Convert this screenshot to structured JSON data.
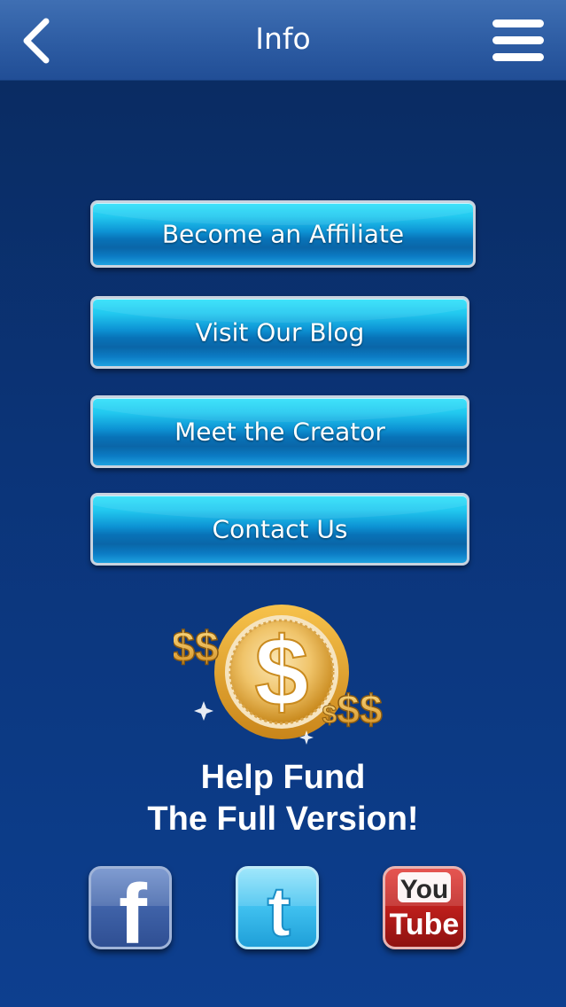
{
  "header": {
    "title": "Info",
    "back_icon": "chevron-left-icon",
    "menu_icon": "hamburger-menu-icon"
  },
  "menu": {
    "items": [
      {
        "label": "Become an Affiliate"
      },
      {
        "label": "Visit Our Blog"
      },
      {
        "label": "Meet the Creator"
      },
      {
        "label": "Contact Us"
      }
    ]
  },
  "fund": {
    "icon": "gold-dollar-coin-icon",
    "line1": "Help Fund",
    "line2": "The Full Version!"
  },
  "social": {
    "facebook": {
      "icon": "facebook-icon",
      "text": "f"
    },
    "twitter": {
      "icon": "twitter-icon",
      "text": "t"
    },
    "youtube": {
      "icon": "youtube-icon",
      "line1": "You",
      "line2": "Tube"
    }
  },
  "colors": {
    "background": "#0b3478",
    "navbar": "#2d5ca3",
    "button_top": "#30e2fb",
    "button_bottom": "#0a66a8",
    "coin_gold": "#e7a52d"
  }
}
